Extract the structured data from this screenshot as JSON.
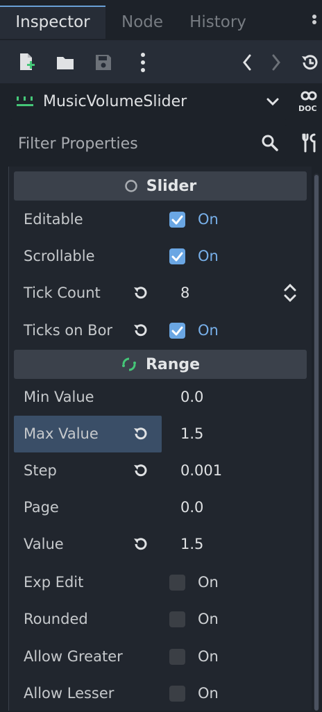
{
  "tabs": [
    {
      "label": "Inspector",
      "active": true
    },
    {
      "label": "Node",
      "active": false
    },
    {
      "label": "History",
      "active": false
    }
  ],
  "toolbar": {
    "icons": [
      "new-resource-icon",
      "open-folder-icon",
      "save-icon",
      "more-vert-icon",
      "back-icon",
      "forward-icon",
      "history-icon"
    ]
  },
  "node_selector": {
    "label": "MusicVolumeSlider",
    "icon": "hslider-node-icon",
    "doc_icon": "doc-icon"
  },
  "filter": {
    "placeholder": "Filter Properties",
    "value": ""
  },
  "sections": [
    {
      "title": "Slider",
      "icon": "circle-icon"
    },
    {
      "title": "Range",
      "icon": "range-icon"
    }
  ],
  "slider_props": [
    {
      "label": "Editable",
      "kind": "check",
      "checked": true,
      "text": "On",
      "revert": false
    },
    {
      "label": "Scrollable",
      "kind": "check",
      "checked": true,
      "text": "On",
      "revert": false
    },
    {
      "label": "Tick Count",
      "kind": "spin",
      "value": "8",
      "revert": true
    },
    {
      "label": "Ticks on Bor",
      "kind": "check",
      "checked": true,
      "text": "On",
      "revert": true
    }
  ],
  "range_props": [
    {
      "label": "Min Value",
      "kind": "number",
      "value": "0.0",
      "revert": false
    },
    {
      "label": "Max Value",
      "kind": "number",
      "value": "1.5",
      "revert": true,
      "highlighted": true
    },
    {
      "label": "Step",
      "kind": "number",
      "value": "0.001",
      "revert": true
    },
    {
      "label": "Page",
      "kind": "number",
      "value": "0.0",
      "revert": false
    },
    {
      "label": "Value",
      "kind": "number",
      "value": "1.5",
      "revert": true
    },
    {
      "label": "Exp Edit",
      "kind": "check",
      "checked": false,
      "text": "On",
      "revert": false
    },
    {
      "label": "Rounded",
      "kind": "check",
      "checked": false,
      "text": "On",
      "revert": false
    },
    {
      "label": "Allow Greater",
      "kind": "check",
      "checked": false,
      "text": "On",
      "revert": false
    },
    {
      "label": "Allow Lesser",
      "kind": "check",
      "checked": false,
      "text": "On",
      "revert": false
    }
  ],
  "colors": {
    "accent": "#6aa6e3",
    "highlight": "#3a4e67",
    "panel": "#21262e",
    "section": "#3b414b",
    "range_icon": "#45c778"
  }
}
